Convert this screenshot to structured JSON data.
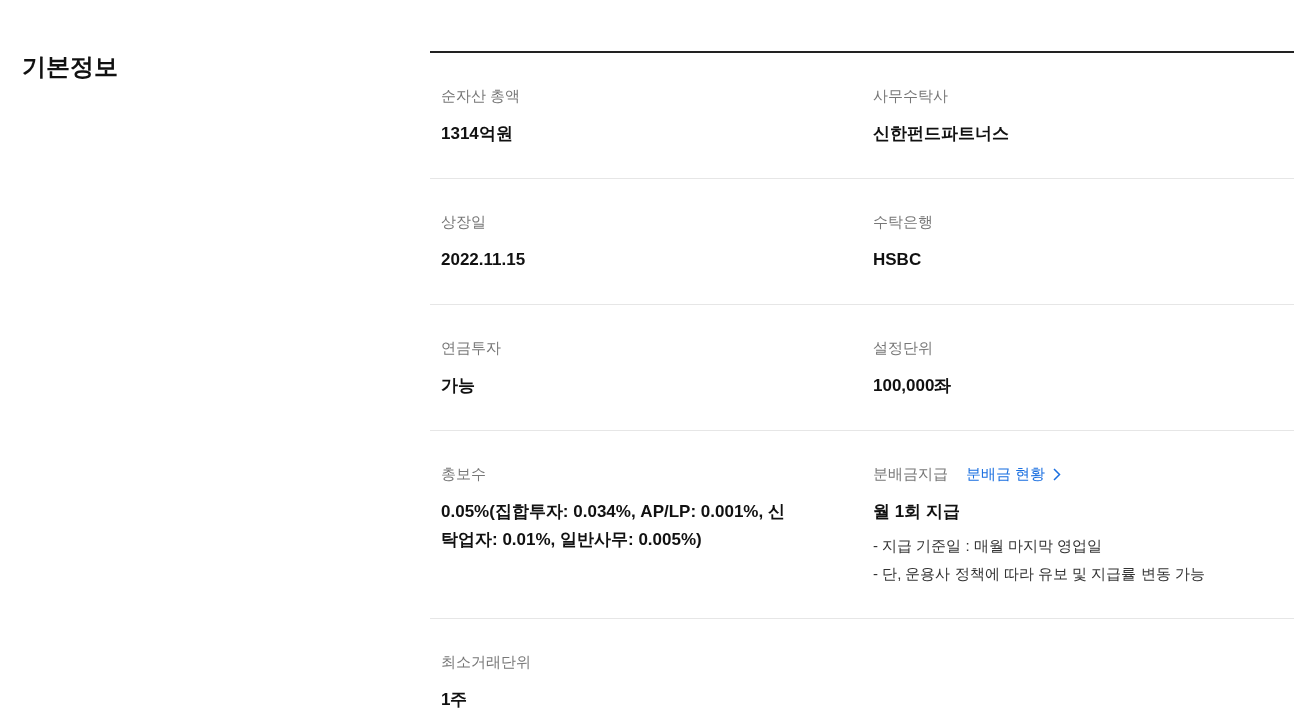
{
  "section": {
    "title": "기본정보"
  },
  "fields": [
    {
      "label": "순자산 총액",
      "value": "1314억원"
    },
    {
      "label": "사무수탁사",
      "value": "신한펀드파트너스"
    },
    {
      "label": "상장일",
      "value": "2022.11.15"
    },
    {
      "label": "수탁은행",
      "value": "HSBC"
    },
    {
      "label": "연금투자",
      "value": "가능"
    },
    {
      "label": "설정단위",
      "value": "100,000좌"
    },
    {
      "label": "총보수",
      "value": "0.05%(집합투자: 0.034%, AP/LP: 0.001%, 신탁업자: 0.01%, 일반사무: 0.005%)"
    },
    {
      "label": "분배금지급",
      "link": "분배금 현황",
      "value": "월 1회 지급",
      "notes": [
        "- 지급 기준일 : 매월 마지막 영업일",
        "- 단, 운용사 정책에 따라 유보 및 지급률 변동 가능"
      ]
    },
    {
      "label": "최소거래단위",
      "value": "1주"
    }
  ]
}
